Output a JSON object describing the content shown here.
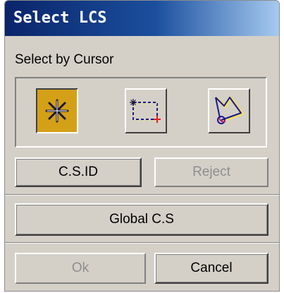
{
  "window": {
    "title": "Select LCS"
  },
  "section": {
    "label": "Select by Cursor"
  },
  "cursor_modes": [
    {
      "icon": "asterisk-select-icon",
      "state": "active"
    },
    {
      "icon": "box-select-icon",
      "state": "inactive"
    },
    {
      "icon": "polygon-select-icon",
      "state": "inactive"
    }
  ],
  "buttons": {
    "csid": "C.S.ID",
    "reject": "Reject",
    "global": "Global C.S",
    "ok": "Ok",
    "cancel": "Cancel"
  },
  "colors": {
    "title_bar": "#0a246a",
    "active_mode": "#d4a017",
    "dialog_bg": "#d4d0c8"
  }
}
